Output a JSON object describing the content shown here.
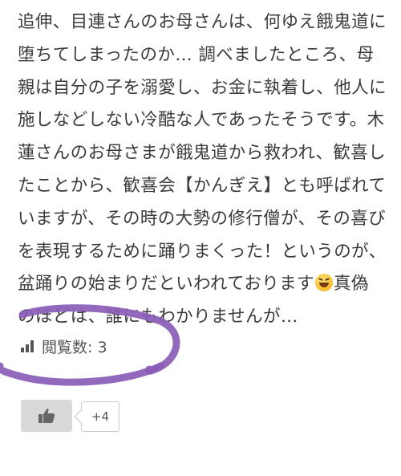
{
  "article": {
    "lines": [
      "追伸、目連さんのお母さんは、何ゆえ餓鬼道に",
      "堕ちてしまったのか… 調べましたところ、母",
      "親は自分の子を溺愛し、お金に執着し、他人に",
      "施しなどしない冷酷な人であったそうです。木",
      "蓮さんのお母さまが餓鬼道から救われ、歓喜し",
      "たことから、歓喜会【かんぎえ】とも呼ばれて",
      "いますが、その時の大勢の修行僧が、その喜び",
      "を表現するために踊りまくった！というのが、",
      "盆踊りの始まりだといわれております",
      "のほどは、誰にもわかりませんが…"
    ],
    "line9_after_emoji": "真偽",
    "emoji": "laughing-face-emoji"
  },
  "stats": {
    "views_label": "閲覧数: 3",
    "icon": "bar-chart-icon"
  },
  "like": {
    "icon": "thumbs-up-icon",
    "count": "+4"
  },
  "annotation": {
    "stroke_color": "#8a5cb8"
  }
}
